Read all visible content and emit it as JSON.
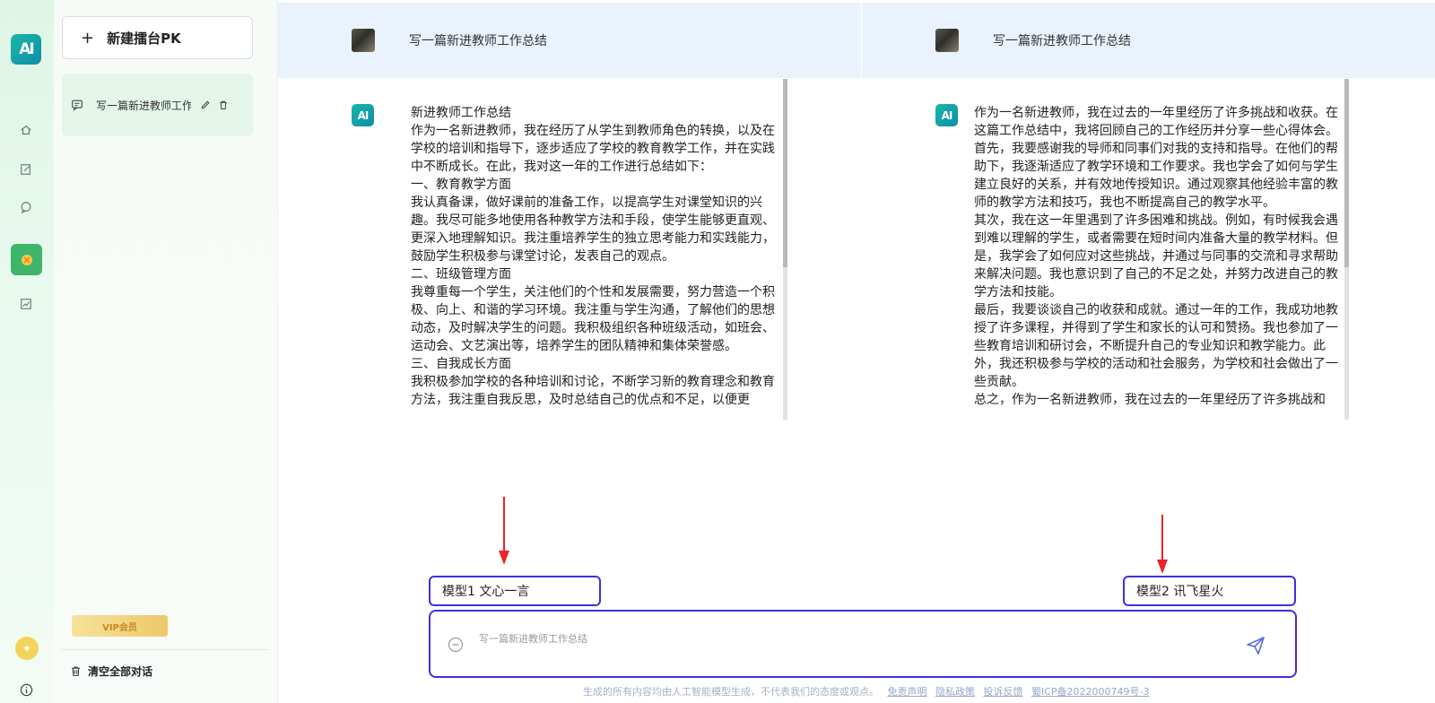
{
  "rail": {
    "logo_text": "AI",
    "items": [
      "home-icon",
      "edit-icon",
      "chat-icon",
      "pk-icon",
      "analytics-icon"
    ],
    "active_color": "#3fb46b"
  },
  "sidebar": {
    "new_button_label": "新建擂台PK",
    "conversation_title": "写一篇新进教师工作总结",
    "vip_label": "VIP会员",
    "clear_all_label": "清空全部对话"
  },
  "panels": [
    {
      "question": "写一篇新进教师工作总结",
      "model_label": "模型1 文心一言",
      "answer": [
        "新进教师工作总结",
        "作为一名新进教师，我在经历了从学生到教师角色的转换，以及在学校的培训和指导下，逐步适应了学校的教育教学工作，并在实践中不断成长。在此，我对这一年的工作进行总结如下：",
        "一、教育教学方面",
        "我认真备课，做好课前的准备工作，以提高学生对课堂知识的兴趣。我尽可能多地使用各种教学方法和手段，使学生能够更直观、更深入地理解知识。我注重培养学生的独立思考能力和实践能力，鼓励学生积极参与课堂讨论，发表自己的观点。",
        "二、班级管理方面",
        "我尊重每一个学生，关注他们的个性和发展需要，努力营造一个积极、向上、和谐的学习环境。我注重与学生沟通，了解他们的思想动态，及时解决学生的问题。我积极组织各种班级活动，如班会、运动会、文艺演出等，培养学生的团队精神和集体荣誉感。",
        "三、自我成长方面",
        "我积极参加学校的各种培训和讨论，不断学习新的教育理念和教育方法，我注重自我反思，及时总结自己的优点和不足，以便更"
      ]
    },
    {
      "question": "写一篇新进教师工作总结",
      "model_label": "模型2 讯飞星火",
      "answer": [
        "作为一名新进教师，我在过去的一年里经历了许多挑战和收获。在这篇工作总结中，我将回顾自己的工作经历并分享一些心得体会。",
        "首先，我要感谢我的导师和同事们对我的支持和指导。在他们的帮助下，我逐渐适应了教学环境和工作要求。我也学会了如何与学生建立良好的关系，并有效地传授知识。通过观察其他经验丰富的教师的教学方法和技巧，我也不断提高自己的教学水平。",
        "其次，我在这一年里遇到了许多困难和挑战。例如，有时候我会遇到难以理解的学生，或者需要在短时间内准备大量的教学材料。但是，我学会了如何应对这些挑战，并通过与同事的交流和寻求帮助来解决问题。我也意识到了自己的不足之处，并努力改进自己的教学方法和技能。",
        "最后，我要谈谈自己的收获和成就。通过一年的工作，我成功地教授了许多课程，并得到了学生和家长的认可和赞扬。我也参加了一些教育培训和研讨会，不断提升自己的专业知识和教学能力。此外，我还积极参与学校的活动和社会服务，为学校和社会做出了一些贡献。",
        "总之，作为一名新进教师，我在过去的一年里经历了许多挑战和"
      ]
    }
  ],
  "input": {
    "placeholder": "写一篇新进教师工作总结"
  },
  "footer": {
    "notice": "生成的所有内容均由人工智能模型生成，不代表我们的态度或观点。",
    "links": [
      "免责声明",
      "隐私政策",
      "投诉反馈",
      "蜀ICP备2022000749号-3"
    ]
  },
  "colors": {
    "accent": "#3d2fe0",
    "arrow": "#e8242a",
    "brand": "#1bb6a6",
    "question_bar": "#eaf3fd"
  }
}
